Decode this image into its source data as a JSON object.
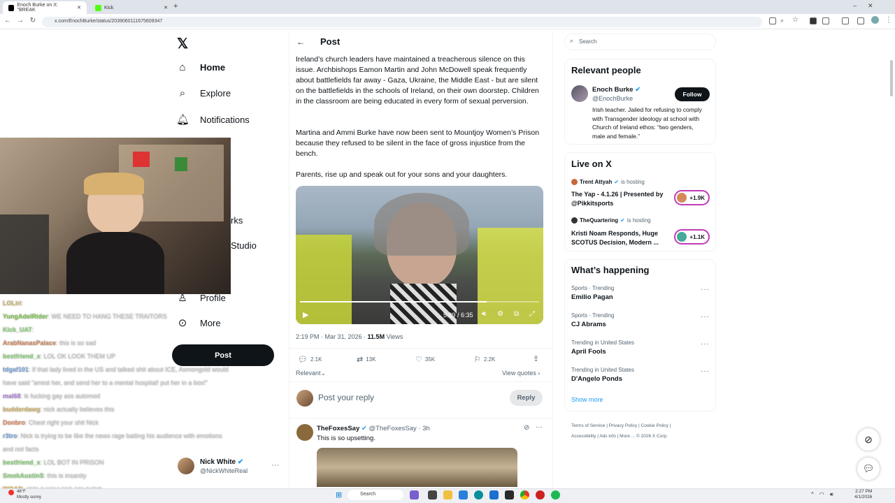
{
  "browser": {
    "tabs": [
      {
        "label": "Enoch Burke on X: \"BREAK",
        "active": true
      },
      {
        "label": "Kick",
        "active": false
      }
    ],
    "url": "x.com/EnochBurke/status/2039060111675609347"
  },
  "nav": {
    "home": "Home",
    "explore": "Explore",
    "notifications": "Notifications",
    "partial1": "n",
    "partial2": "rks",
    "partial3": "Studio",
    "profile": "Profile",
    "more": "More",
    "post_button": "Post",
    "account_name": "Nick White",
    "account_handle": "@NickWhiteReal"
  },
  "chat": [
    {
      "user": "LOLiri",
      "msg": ":",
      "color": "#d4b46a"
    },
    {
      "user": "YungAdelRider",
      "msg": ": WE NEED TO HANG THESE TRAITORS",
      "color": "#7ec850"
    },
    {
      "user": "Kick_UAT",
      "msg": ":",
      "color": "#8ad37a"
    },
    {
      "user": "ArabNanasPalace",
      "msg": ": this is so sad",
      "color": "#d58a60"
    },
    {
      "user": "bestfriend_x",
      "msg": ": LOL OK LOOK THEM UP",
      "color": "#8ad37a"
    },
    {
      "user": "tdgaf101",
      "msg": ": If that lady lived in the US and talked shit about ICE, Asmongold would",
      "color": "#7aa8e0"
    },
    {
      "user": "",
      "msg": "have said \"arrest her, and send her to a mental hospital! put her in a box!\"",
      "color": "#c8c8c8"
    },
    {
      "user": "mal68",
      "msg": ": ik fucking gay ass automod",
      "color": "#b48ae0"
    },
    {
      "user": "budderdawg",
      "msg": ": nick actually believes this",
      "color": "#d4b46a"
    },
    {
      "user": "Donbro",
      "msg": ": Chest right your shit Nick",
      "color": "#e08a60"
    },
    {
      "user": "r3tro",
      "msg": ": Nick is trying to be like the news rage baiting his audience with emotions",
      "color": "#7aa8e0"
    },
    {
      "user": "",
      "msg": "and not facts",
      "color": "#c8c8c8"
    },
    {
      "user": "bestfriend_x",
      "msg": ": LOL BOT IN PRISON",
      "color": "#8ad37a"
    },
    {
      "user": "SmokAustinS",
      "msg": ": this is insanity",
      "color": "#8ad37a"
    },
    {
      "user": "WOAD",
      "msg": ": shits turning kick into twitch",
      "color": "#e0b050"
    }
  ],
  "post": {
    "header": "Post",
    "paragraph1": "Ireland’s church leaders have maintained a treacherous silence on this issue. Archbishops Eamon Martin and John McDowell speak frequently about battlefields far away - Gaza, Ukraine, the Middle East - but are silent on the battlefields in the schools of Ireland, on their own doorstep. Children in the classroom are being educated in every form of sexual perversion.",
    "paragraph2": "Martina and Ammi Burke have now been sent to Mountjoy Women’s Prison because they refused to be silent in the face of gross injustice from the bench.",
    "paragraph3": "Parents, rise up and speak out for your sons and your daughters.",
    "video_time": "5:09 / 6:35",
    "video_progress": 0.78,
    "timestamp": "2:19 PM · Mar 31, 2026 · ",
    "views_count": "11.5M",
    "views_label": " Views",
    "replies": "2.1K",
    "reposts": "13K",
    "likes": "35K",
    "bookmarks": "2.2K",
    "relevant": "Relevant",
    "view_quotes": "View quotes",
    "reply_placeholder": "Post your reply",
    "reply_button": "Reply"
  },
  "reply_tweet": {
    "name": "TheFoxesSay",
    "handle": "@TheFoxesSay · 3h",
    "text": "This is so upsetting."
  },
  "sidebar": {
    "search_placeholder": "Search",
    "relevant_title": "Relevant people",
    "person_name": "Enoch Burke",
    "person_handle": "@EnochBurke",
    "person_bio": "Irish teacher. Jailed for refusing to comply with Transgender ideology at school with Church of Ireland ethos: “two genders, male and female.”",
    "follow": "Follow",
    "live_title": "Live on X",
    "live": [
      {
        "host": "Trent Attyah",
        "status": "is hosting",
        "title": "The Yap - 4.1.26 | Presented by @Pikkitsports",
        "count": "+1.9K"
      },
      {
        "host": "TheQuartering",
        "status": "is hosting",
        "title": "Kristi Noam Responds, Huge SCOTUS Decision, Modern ...",
        "count": "+1.1K"
      }
    ],
    "happening_title": "What’s happening",
    "trends": [
      {
        "context": "Sports · Trending",
        "name": "Emilio Pagan"
      },
      {
        "context": "Sports · Trending",
        "name": "CJ Abrams"
      },
      {
        "context": "Trending in United States",
        "name": "April Fools"
      },
      {
        "context": "Trending in United States",
        "name": "D'Angelo Ponds"
      }
    ],
    "show_more": "Show more",
    "footer": [
      "Terms of Service",
      "Privacy Policy",
      "Cookie Policy",
      "Accessibility",
      "Ads info",
      "More ...",
      "© 2026 X Corp."
    ]
  },
  "taskbar": {
    "weather_temp": "48°F",
    "weather_desc": "Mostly sunny",
    "search": "Search",
    "time": "2:27 PM",
    "date": "4/1/2026"
  },
  "colors": {
    "accent": "#1d9bf0",
    "verified": "#1d9bf0",
    "dark": "#0f1419"
  }
}
